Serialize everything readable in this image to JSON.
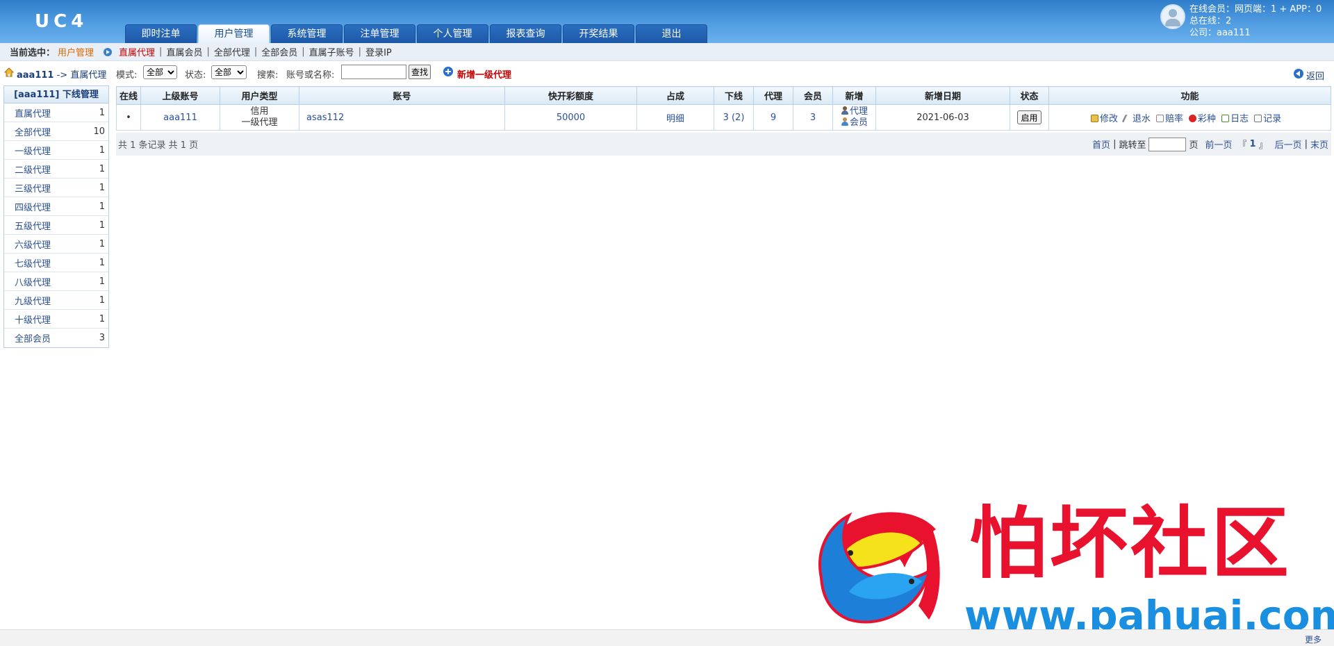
{
  "app": {
    "logo": "UC4"
  },
  "nav": {
    "tabs": [
      {
        "label": "即时注单"
      },
      {
        "label": "用户管理"
      },
      {
        "label": "系统管理"
      },
      {
        "label": "注单管理"
      },
      {
        "label": "个人管理"
      },
      {
        "label": "报表查询"
      },
      {
        "label": "开奖结果"
      },
      {
        "label": "退出"
      }
    ],
    "active_tab": "用户管理"
  },
  "online": {
    "line1": "在线会员：网页端：1 + APP：0",
    "line2": "总在线：2",
    "line3": "公司：aaa111"
  },
  "subbar": {
    "current_label": "当前选中：",
    "current_value": "用户管理",
    "links": [
      "直属代理",
      "直属会员",
      "全部代理",
      "全部会员",
      "直属子账号",
      "登录IP"
    ],
    "active_link": "直属代理",
    "separator": "|"
  },
  "toolbar": {
    "crumb_user": "aaa111",
    "crumb_rest": " -> 直属代理",
    "mode_label": "模式:",
    "mode_value": "全部",
    "status_label": "状态:",
    "status_value": "全部",
    "search_label": "搜索:",
    "search_hint": "账号或名称:",
    "search_value": "",
    "search_button": "查找",
    "add_label": "新增一级代理",
    "back_label": "返回"
  },
  "sidebar": {
    "title": "[aaa111] 下线管理",
    "items": [
      {
        "label": "直属代理",
        "count": "1"
      },
      {
        "label": "全部代理",
        "count": "10"
      },
      {
        "label": "一级代理",
        "count": "1"
      },
      {
        "label": "二级代理",
        "count": "1"
      },
      {
        "label": "三级代理",
        "count": "1"
      },
      {
        "label": "四级代理",
        "count": "1"
      },
      {
        "label": "五级代理",
        "count": "1"
      },
      {
        "label": "六级代理",
        "count": "1"
      },
      {
        "label": "七级代理",
        "count": "1"
      },
      {
        "label": "八级代理",
        "count": "1"
      },
      {
        "label": "九级代理",
        "count": "1"
      },
      {
        "label": "十级代理",
        "count": "1"
      },
      {
        "label": "全部会员",
        "count": "3"
      }
    ]
  },
  "table": {
    "headers": [
      "在线",
      "上级账号",
      "用户类型",
      "账号",
      "快开彩额度",
      "占成",
      "下线",
      "代理",
      "会员",
      "新增",
      "新增日期",
      "状态",
      "功能"
    ],
    "rows": [
      {
        "online": "•",
        "parent": "aaa111",
        "type_line1": "信用",
        "type_line2": "一级代理",
        "account": "asas112",
        "quota": "50000",
        "share": "明细",
        "downline": "3 (2)",
        "agents": "9",
        "members": "3",
        "new_agent": "代理",
        "new_member": "会员",
        "date": "2021-06-03",
        "status": "启用",
        "ops": {
          "edit": "修改",
          "water": "退水",
          "odds": "赔率",
          "lottery": "彩种",
          "log": "日志",
          "record": "记录"
        }
      }
    ]
  },
  "pager": {
    "summary": "共 1 条记录  共 1 页",
    "first": "首页",
    "jump_label": "跳转至",
    "page_unit": "页",
    "prev": "前一页",
    "bracket_left": "『",
    "current": "1",
    "bracket_right": "』",
    "next": "后一页",
    "last": "末页",
    "sep": "|"
  },
  "watermark": {
    "text": "怕坏社区",
    "url": "www.pahuai.com"
  },
  "footer": {
    "more": "更多"
  },
  "colors": {
    "header_blue": "#4c98df",
    "accent_red": "#cc0000",
    "link_blue": "#2d4f9a",
    "watermark_red": "#e8122f"
  }
}
